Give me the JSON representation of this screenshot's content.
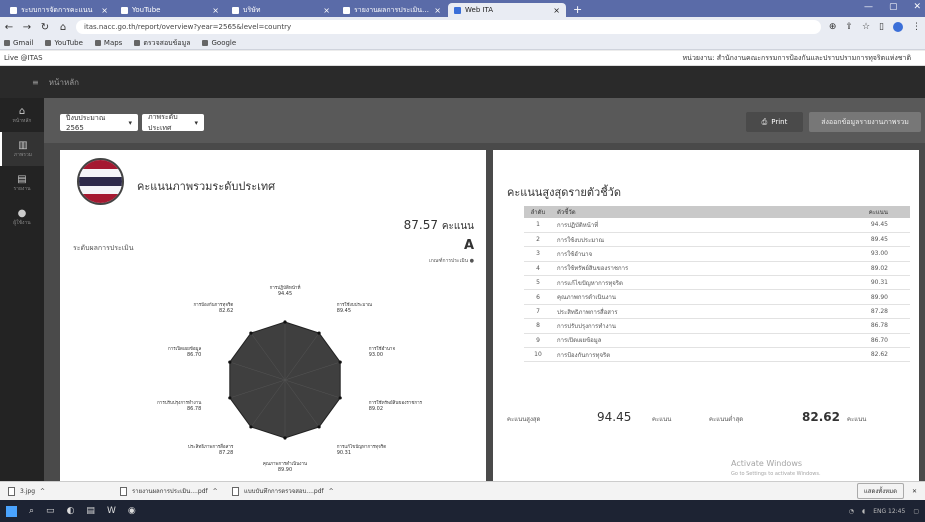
{
  "browser": {
    "tabs": [
      {
        "title": "ระบบการจัดการคะแนน",
        "active": false
      },
      {
        "title": "YouTube",
        "active": false
      },
      {
        "title": "บริษัท",
        "active": false
      },
      {
        "title": "รายงานผลการประเมินความเสี่ยงแห่งชาติ",
        "active": false
      },
      {
        "title": "Web ITA",
        "active": true
      }
    ],
    "new_tab": "+",
    "url": "itas.nacc.go.th/report/overview?year=2565&level=country",
    "bookmarks": [
      "Gmail",
      "YouTube",
      "Maps",
      "ตรวจสอบข้อมูล",
      "Google"
    ],
    "site_label": "Live @ITAS",
    "site_user": "หน่วยงาน: สำนักงานคณะกรรมการป้องกันและปราบปรามการทุจริตแห่งชาติ"
  },
  "app": {
    "top_menu": "หน้าหลัก",
    "sidenav": [
      {
        "label": "หน้าหลัก",
        "icon": "home-icon"
      },
      {
        "label": "ภาพรวม",
        "icon": "chart-icon"
      },
      {
        "label": "รายงาน",
        "icon": "report-icon"
      },
      {
        "label": "ผู้ใช้งาน",
        "icon": "user-icon"
      }
    ],
    "filters": {
      "year": "ปีงบประมาณ 2565",
      "type": "ภาพระดับประเทศ"
    },
    "print_label": "Print",
    "export_label": "ส่งออกข้อมูลรายงานภาพรวม"
  },
  "overall": {
    "title": "คะแนนภาพรวมระดับประเทศ",
    "score": "87.57",
    "score_unit": "คะแนน",
    "grade_label": "ระดับผลการประเมิน",
    "grade": "A",
    "grade_criteria": "เกณฑ์การประเมิน"
  },
  "radar": {
    "labels": [
      {
        "name": "การปฏิบัติหน้าที่",
        "value": "94.45"
      },
      {
        "name": "การใช้งบประมาณ",
        "value": "89.45"
      },
      {
        "name": "การใช้อำนาจ",
        "value": "93.00"
      },
      {
        "name": "การใช้ทรัพย์สินของราชการ",
        "value": "89.02"
      },
      {
        "name": "การแก้ไขปัญหาการทุจริต",
        "value": "90.31"
      },
      {
        "name": "คุณภาพการดำเนินงาน",
        "value": "89.90"
      },
      {
        "name": "ประสิทธิภาพการสื่อสาร",
        "value": "87.28"
      },
      {
        "name": "การปรับปรุงการทำงาน",
        "value": "86.78"
      },
      {
        "name": "การเปิดเผยข้อมูล",
        "value": "86.70"
      },
      {
        "name": "การป้องกันการทุจริต",
        "value": "82.62"
      }
    ]
  },
  "ranking": {
    "title": "คะแนนสูงสุดรายตัวชี้วัด",
    "headers": [
      "ลำดับ",
      "ตัวชี้วัด",
      "คะแนน"
    ],
    "rows": [
      {
        "no": "1",
        "name": "การปฏิบัติหน้าที่",
        "score": "94.45"
      },
      {
        "no": "2",
        "name": "การใช้งบประมาณ",
        "score": "89.45"
      },
      {
        "no": "3",
        "name": "การใช้อำนาจ",
        "score": "93.00"
      },
      {
        "no": "4",
        "name": "การใช้ทรัพย์สินของราชการ",
        "score": "89.02"
      },
      {
        "no": "5",
        "name": "การแก้ไขปัญหาการทุจริต",
        "score": "90.31"
      },
      {
        "no": "6",
        "name": "คุณภาพการดำเนินงาน",
        "score": "89.90"
      },
      {
        "no": "7",
        "name": "ประสิทธิภาพการสื่อสาร",
        "score": "87.28"
      },
      {
        "no": "8",
        "name": "การปรับปรุงการทำงาน",
        "score": "86.78"
      },
      {
        "no": "9",
        "name": "การเปิดเผยข้อมูล",
        "score": "86.70"
      },
      {
        "no": "10",
        "name": "การป้องกันการทุจริต",
        "score": "82.62"
      }
    ],
    "max_label": "คะแนนสูงสุด",
    "max_value": "94.45",
    "max_unit": "คะแนน",
    "min_label": "คะแนนต่ำสุด",
    "min_value": "82.62",
    "min_unit": "คะแนน"
  },
  "watermark": {
    "line1": "Activate Windows",
    "line2": "Go to Settings to activate Windows."
  },
  "downloads": {
    "items": [
      "3.jpg",
      "รายงานผลการประเมิน....pdf",
      "แบบบันทึกการตรวจสอบ....pdf"
    ],
    "show_all": "แสดงทั้งหมด"
  },
  "taskbar": {
    "tray": "ENG  12:45"
  },
  "colors": {
    "radar_fill": "#3f3f3f",
    "header_bg": "#595959",
    "tabbar": "#5a6ba8"
  }
}
